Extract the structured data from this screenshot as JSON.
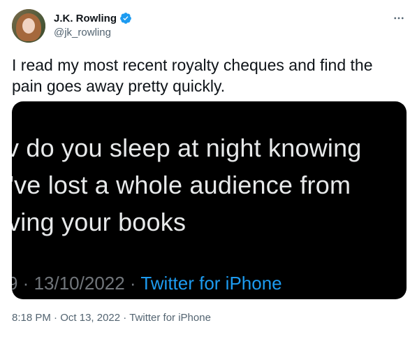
{
  "author": {
    "display_name": "J.K. Rowling",
    "handle": "@jk_rowling",
    "verified": true
  },
  "tweet": {
    "text": "I read my most recent royalty cheques and find the pain goes away pretty quickly."
  },
  "media": {
    "lines": [
      "v do you sleep at night knowing",
      "'ve lost a whole audience from",
      "ving your books"
    ],
    "meta_prefix": "9 · 13/10/2022 · ",
    "meta_source": "Twitter for iPhone"
  },
  "footer": {
    "time": "8:18 PM",
    "separator": " · ",
    "date": "Oct 13, 2022",
    "source": "Twitter for iPhone"
  },
  "colors": {
    "accent": "#1d9bf0",
    "text_primary": "#0f1419",
    "text_secondary": "#536471",
    "media_bg": "#000000"
  },
  "icons": {
    "verified": "verified-badge-icon",
    "more": "more-options-icon"
  }
}
